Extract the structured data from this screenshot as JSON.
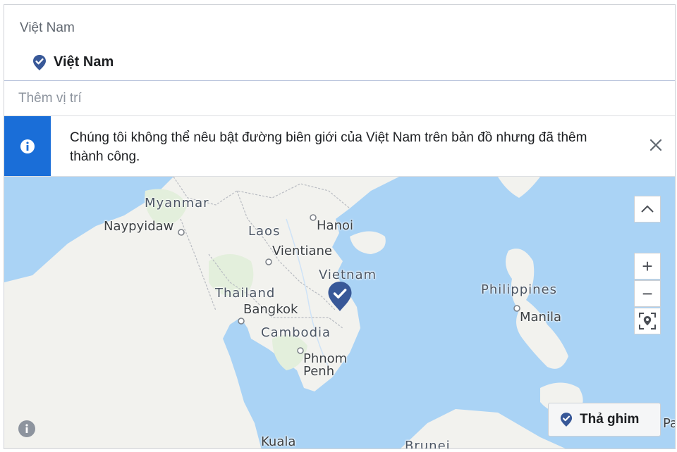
{
  "location": {
    "label": "Việt Nam",
    "selected": "Việt Nam",
    "add_placeholder": "Thêm vị trí"
  },
  "notice": {
    "message": "Chúng tôi không thể nêu bật đường biên giới của Việt Nam trên bản đồ nhưng đã thêm thành công.",
    "close_icon": "close-icon"
  },
  "map": {
    "labels": {
      "myanmar": "Myanmar",
      "naypyidaw": "Naypyidaw",
      "laos": "Laos",
      "hanoi": "Hanoi",
      "vientiane": "Vientiane",
      "vietnam": "Vietnam",
      "thailand": "Thailand",
      "bangkok": "Bangkok",
      "cambodia": "Cambodia",
      "phnom_penh_1": "Phnom",
      "phnom_penh_2": "Penh",
      "philippines": "Philippines",
      "manila": "Manila",
      "kuala": "Kuala",
      "brunei": "Brunei",
      "pa": "Pa"
    },
    "controls": {
      "collapse_icon": "chevron-up-icon",
      "zoom_in": "+",
      "zoom_out": "−",
      "locate_icon": "locate-icon"
    },
    "drop_pin_label": "Thả ghim",
    "colors": {
      "water": "#aad3f5",
      "land": "#f2f2ee",
      "marker": "#385898",
      "info_bar": "#1a6ed8"
    }
  }
}
